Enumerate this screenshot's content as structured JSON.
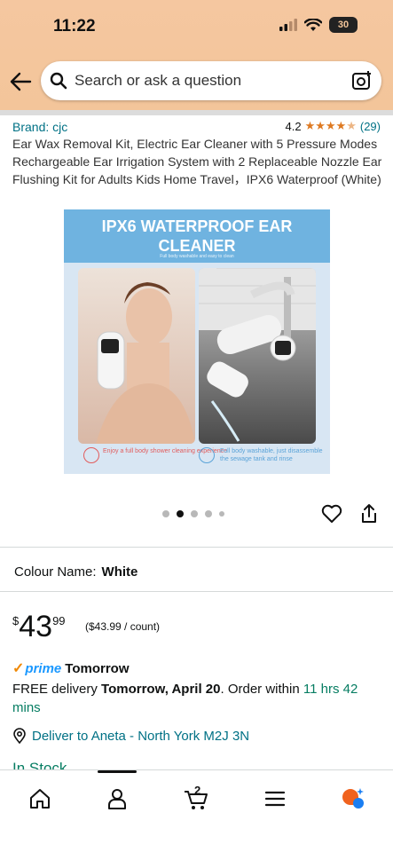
{
  "status_bar": {
    "time": "11:22",
    "battery": "30"
  },
  "search": {
    "placeholder": "Search or ask a question"
  },
  "product": {
    "brand": "Brand: cjc",
    "rating": "4.2",
    "rating_count": "(29)",
    "title": "Ear Wax Removal Kit, Electric Ear Cleaner with 5 Pressure Modes Rechargeable Ear Irrigation System with 2 Replaceable Nozzle Ear Flushing Kit for Adults Kids Home Travel，IPX6 Waterproof (White)",
    "image": {
      "headline": "IPX6 WATERPROOF EAR CLEANER",
      "subline": "Full body washable and easy to clean",
      "caption_left": "Enjoy a full body shower cleaning experience",
      "caption_right": "Full body washable, just disassemble the sewage tank and rinse"
    },
    "carousel_count": 5,
    "carousel_active": 1
  },
  "colour": {
    "label": "Colour Name:",
    "value": "White"
  },
  "price": {
    "currency": "$",
    "whole": "43",
    "fraction": "99",
    "unit": "($43.99 / count)"
  },
  "delivery": {
    "prime_label": "prime",
    "prime_day": "Tomorrow",
    "line_prefix": "FREE delivery ",
    "date": "Tomorrow, April 20",
    "order_within": ". Order within ",
    "countdown": "11 hrs 42 mins",
    "location": "Deliver to Aneta - North York M2J 3N"
  },
  "stock": "In Stock",
  "bottom_nav": {
    "cart_count": "2"
  },
  "colors": {
    "link": "#007185",
    "star": "#de7921",
    "prime": "#1a98ff",
    "green": "#067d62",
    "header": "#f3c59a"
  }
}
